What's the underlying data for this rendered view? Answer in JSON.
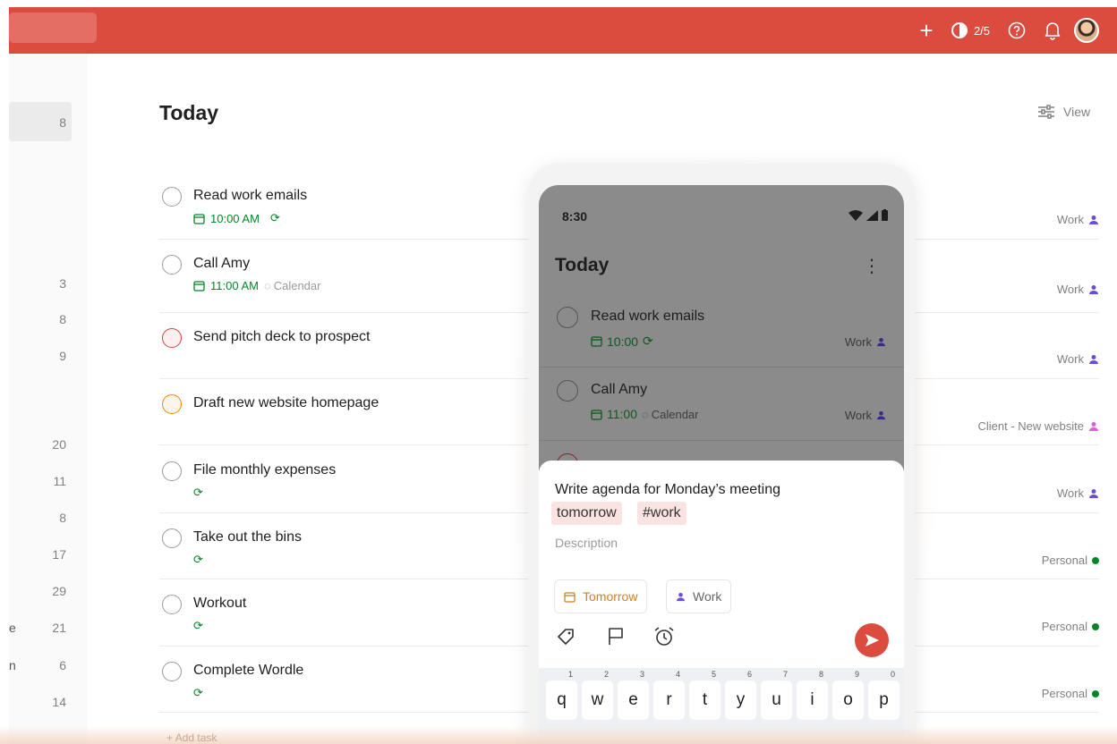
{
  "topbar": {
    "karma": "2/5",
    "icons": [
      "plus-icon",
      "productivity-icon",
      "help-icon",
      "bell-icon",
      "avatar"
    ]
  },
  "sidebar": {
    "counts": [
      "8",
      "3",
      "8",
      "9",
      "20",
      "11",
      "8",
      "17",
      "29",
      "21",
      "6",
      "14"
    ],
    "fragments": [
      "e",
      "n"
    ]
  },
  "main": {
    "title": "Today",
    "view_label": "View",
    "tasks": [
      {
        "title": "Read work emails",
        "time": "10:00 AM",
        "recurring": true,
        "label": "",
        "project": "Work",
        "priority": "none"
      },
      {
        "title": "Call Amy",
        "time": "11:00 AM",
        "recurring": false,
        "label": "Calendar",
        "project": "Work",
        "priority": "none"
      },
      {
        "title": "Send pitch deck to prospect",
        "time": "",
        "recurring": false,
        "label": "",
        "project": "Work",
        "priority": "p1"
      },
      {
        "title": "Draft new website homepage",
        "time": "",
        "recurring": false,
        "label": "",
        "project": "Client - New website",
        "priority": "p2"
      },
      {
        "title": "File monthly expenses",
        "time": "",
        "recurring": true,
        "label": "",
        "project": "Work",
        "priority": "none"
      },
      {
        "title": "Take out the bins",
        "time": "",
        "recurring": true,
        "label": "",
        "project": "Personal",
        "priority": "none"
      },
      {
        "title": "Workout",
        "time": "",
        "recurring": true,
        "label": "",
        "project": "Personal",
        "priority": "none"
      },
      {
        "title": "Complete Wordle",
        "time": "",
        "recurring": true,
        "label": "",
        "project": "Personal",
        "priority": "none"
      }
    ],
    "add_task": "Add task"
  },
  "phone": {
    "status_time": "8:30",
    "title": "Today",
    "tasks": [
      {
        "title": "Read work emails",
        "time": "10:00",
        "label": "",
        "project": "Work"
      },
      {
        "title": "Call Amy",
        "time": "11:00",
        "label": "Calendar",
        "project": "Work"
      }
    ],
    "quick_add": {
      "text": "Write agenda for Monday’s meeting",
      "chip_date": "tomorrow",
      "chip_tag": "#work",
      "description_placeholder": "Description",
      "date_button": "Tomorrow",
      "project_button": "Work"
    },
    "keyboard": {
      "keys": [
        "q",
        "w",
        "e",
        "r",
        "t",
        "y",
        "u",
        "i",
        "o",
        "p"
      ],
      "hints": [
        "1",
        "2",
        "3",
        "4",
        "5",
        "6",
        "7",
        "8",
        "9",
        "0"
      ]
    }
  },
  "colors": {
    "brand": "#db4c3f",
    "green": "#058527",
    "p1": "#d1453b",
    "p2": "#eb8909",
    "work": "#6c4dd3",
    "client": "#e05ce0"
  }
}
